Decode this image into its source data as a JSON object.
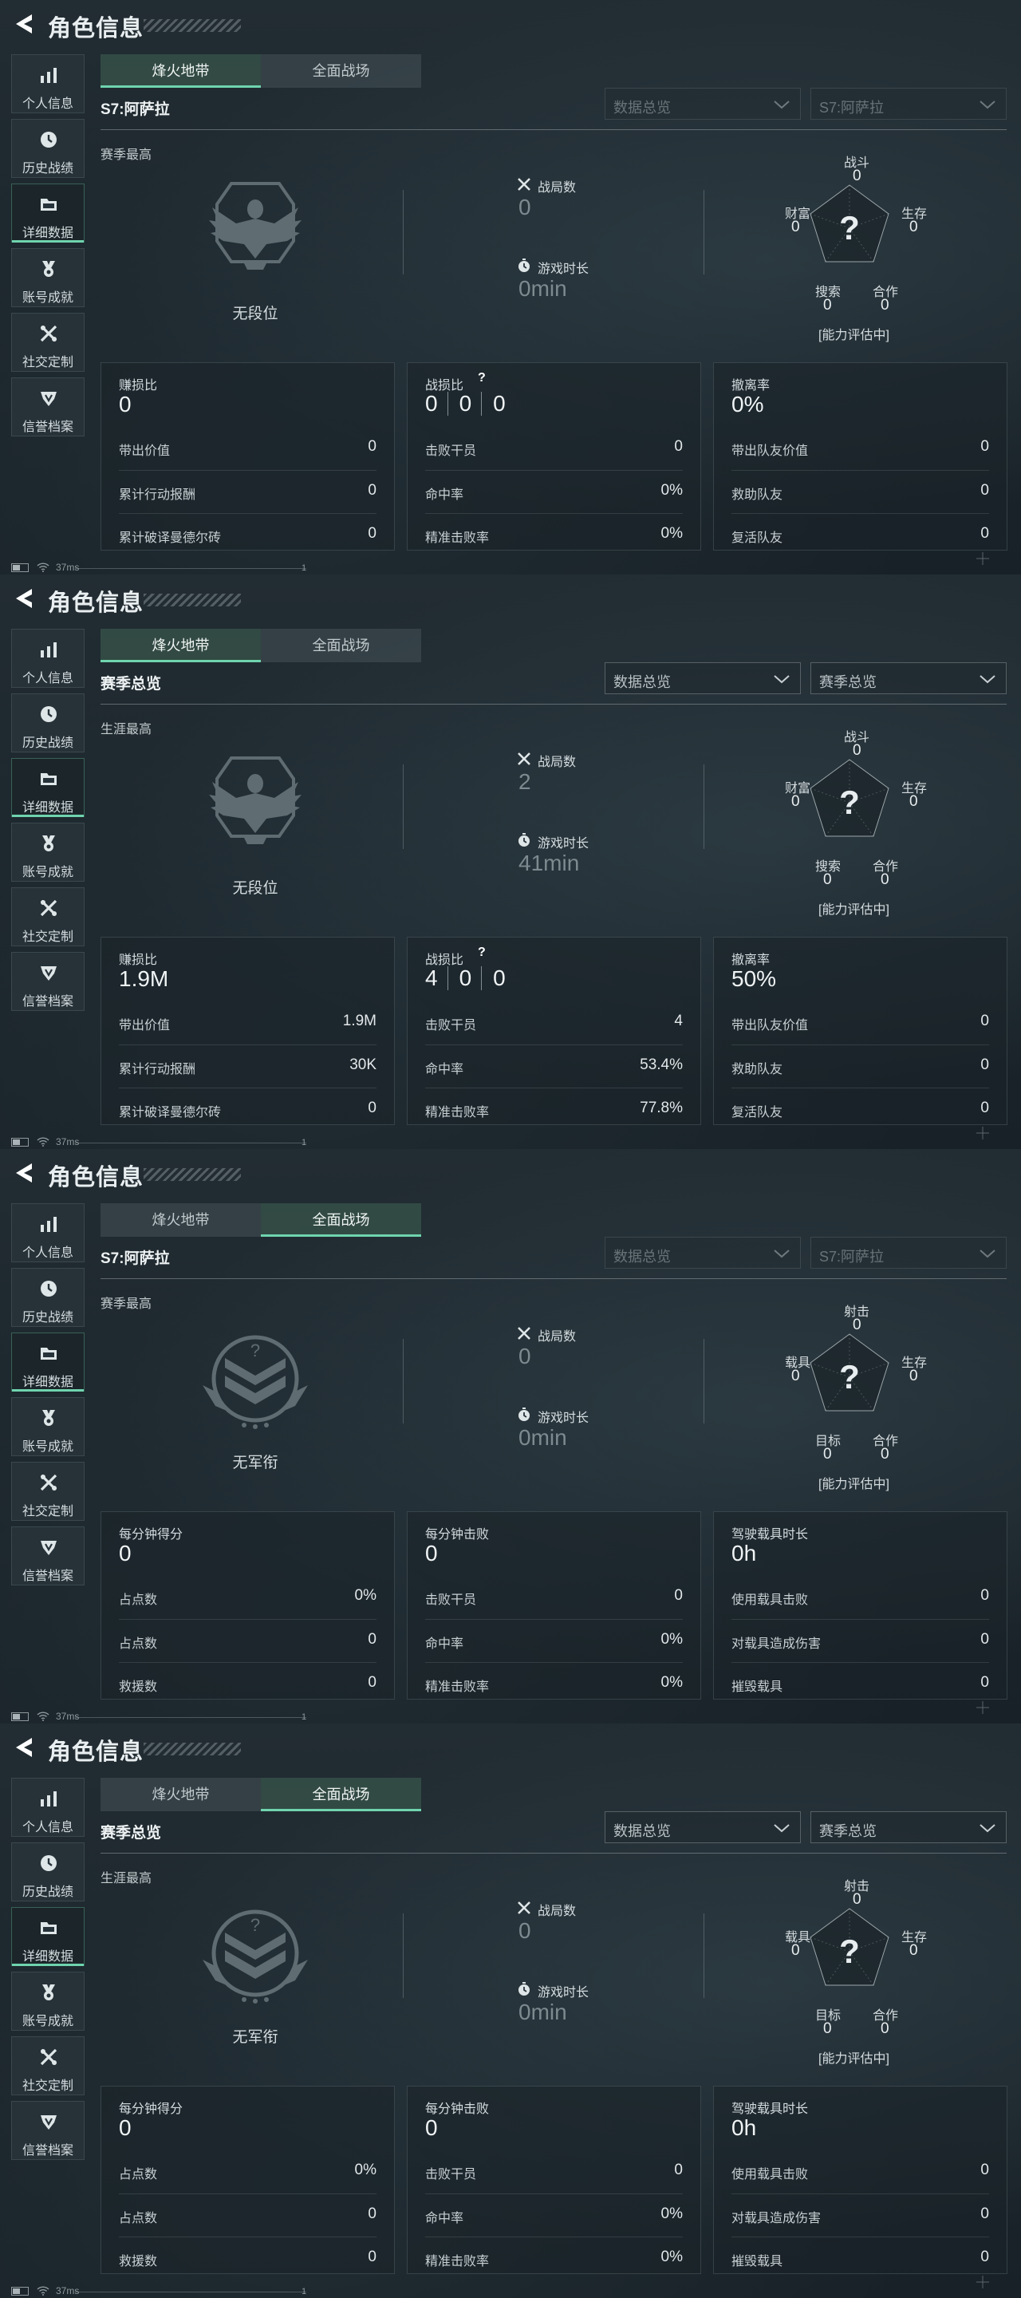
{
  "colors": {
    "accent": "#6fd4ae",
    "panel_bg": "#1b252b",
    "text": "#d4dcdf",
    "dim_value": "#7d8a8f"
  },
  "common": {
    "header_title": "角色信息",
    "sidebar": [
      {
        "label": "个人信息",
        "icon": "bar-chart-icon"
      },
      {
        "label": "历史战绩",
        "icon": "clock-icon"
      },
      {
        "label": "详细数据",
        "icon": "folder-icon"
      },
      {
        "label": "账号成就",
        "icon": "medal-icon"
      },
      {
        "label": "社交定制",
        "icon": "tools-icon"
      },
      {
        "label": "信誉档案",
        "icon": "shield-icon"
      }
    ],
    "active_sidebar_index": 2,
    "tabs": [
      "烽火地带",
      "全面战场"
    ],
    "stat_matches_label": "战局数",
    "stat_time_label": "游戏时长",
    "radar_status": "[能力评估中]",
    "status_ping": "37ms",
    "status_mark": "1"
  },
  "panels": [
    {
      "active_tab": 0,
      "season_label": "S7:阿萨拉",
      "select_1": "数据总览",
      "select_2": "S7:阿萨拉",
      "selects_dim": true,
      "best_label": "赛季最高",
      "rank_type": "eagle",
      "rank_name": "无段位",
      "matches": "0",
      "play_time": "0min",
      "radar": {
        "top": "战斗",
        "top_val": "0",
        "left": "财富",
        "left_val": "0",
        "right": "生存",
        "right_val": "0",
        "bl": "搜索",
        "bl_val": "0",
        "br": "合作",
        "br_val": "0"
      },
      "cards": [
        {
          "head": "赚损比",
          "big": "0",
          "rows": [
            [
              "带出价值",
              "0"
            ],
            [
              "累计行动报酬",
              "0"
            ],
            [
              "累计破译曼德尔砖",
              "0"
            ]
          ]
        },
        {
          "head": "战损比",
          "kd": [
            "0",
            "0",
            "0"
          ],
          "rows": [
            [
              "击败干员",
              "0"
            ],
            [
              "命中率",
              "0%"
            ],
            [
              "精准击败率",
              "0%"
            ]
          ]
        },
        {
          "head": "撤离率",
          "big": "0%",
          "rows": [
            [
              "带出队友价值",
              "0"
            ],
            [
              "救助队友",
              "0"
            ],
            [
              "复活队友",
              "0"
            ]
          ]
        }
      ]
    },
    {
      "active_tab": 0,
      "season_label": "赛季总览",
      "select_1": "数据总览",
      "select_2": "赛季总览",
      "selects_dim": false,
      "best_label": "生涯最高",
      "rank_type": "eagle",
      "rank_name": "无段位",
      "matches": "2",
      "play_time": "41min",
      "radar": {
        "top": "战斗",
        "top_val": "0",
        "left": "财富",
        "left_val": "0",
        "right": "生存",
        "right_val": "0",
        "bl": "搜索",
        "bl_val": "0",
        "br": "合作",
        "br_val": "0"
      },
      "cards": [
        {
          "head": "赚损比",
          "big": "1.9M",
          "rows": [
            [
              "带出价值",
              "1.9M"
            ],
            [
              "累计行动报酬",
              "30K"
            ],
            [
              "累计破译曼德尔砖",
              "0"
            ]
          ]
        },
        {
          "head": "战损比",
          "kd": [
            "4",
            "0",
            "0"
          ],
          "rows": [
            [
              "击败干员",
              "4"
            ],
            [
              "命中率",
              "53.4%"
            ],
            [
              "精准击败率",
              "77.8%"
            ]
          ]
        },
        {
          "head": "撤离率",
          "big": "50%",
          "rows": [
            [
              "带出队友价值",
              "0"
            ],
            [
              "救助队友",
              "0"
            ],
            [
              "复活队友",
              "0"
            ]
          ]
        }
      ]
    },
    {
      "active_tab": 1,
      "season_label": "S7:阿萨拉",
      "select_1": "数据总览",
      "select_2": "S7:阿萨拉",
      "selects_dim": true,
      "best_label": "赛季最高",
      "rank_type": "chevron",
      "rank_name": "无军衔",
      "matches": "0",
      "play_time": "0min",
      "radar": {
        "top": "射击",
        "top_val": "0",
        "left": "载具",
        "left_val": "0",
        "right": "生存",
        "right_val": "0",
        "bl": "目标",
        "bl_val": "0",
        "br": "合作",
        "br_val": "0"
      },
      "cards": [
        {
          "head": "每分钟得分",
          "big": "0",
          "rows": [
            [
              "占点数",
              "0%"
            ],
            [
              "占点数",
              "0"
            ],
            [
              "救援数",
              "0"
            ]
          ]
        },
        {
          "head": "每分钟击败",
          "big": "0",
          "rows": [
            [
              "击败干员",
              "0"
            ],
            [
              "命中率",
              "0%"
            ],
            [
              "精准击败率",
              "0%"
            ]
          ]
        },
        {
          "head": "驾驶载具时长",
          "big": "0h",
          "rows": [
            [
              "使用载具击败",
              "0"
            ],
            [
              "对载具造成伤害",
              "0"
            ],
            [
              "摧毁载具",
              "0"
            ]
          ]
        }
      ]
    },
    {
      "active_tab": 1,
      "season_label": "赛季总览",
      "select_1": "数据总览",
      "select_2": "赛季总览",
      "selects_dim": false,
      "best_label": "生涯最高",
      "rank_type": "chevron",
      "rank_name": "无军衔",
      "matches": "0",
      "play_time": "0min",
      "radar": {
        "top": "射击",
        "top_val": "0",
        "left": "载具",
        "left_val": "0",
        "right": "生存",
        "right_val": "0",
        "bl": "目标",
        "bl_val": "0",
        "br": "合作",
        "br_val": "0"
      },
      "cards": [
        {
          "head": "每分钟得分",
          "big": "0",
          "rows": [
            [
              "占点数",
              "0%"
            ],
            [
              "占点数",
              "0"
            ],
            [
              "救援数",
              "0"
            ]
          ]
        },
        {
          "head": "每分钟击败",
          "big": "0",
          "rows": [
            [
              "击败干员",
              "0"
            ],
            [
              "命中率",
              "0%"
            ],
            [
              "精准击败率",
              "0%"
            ]
          ]
        },
        {
          "head": "驾驶载具时长",
          "big": "0h",
          "rows": [
            [
              "使用载具击败",
              "0"
            ],
            [
              "对载具造成伤害",
              "0"
            ],
            [
              "摧毁载具",
              "0"
            ]
          ]
        }
      ]
    }
  ]
}
